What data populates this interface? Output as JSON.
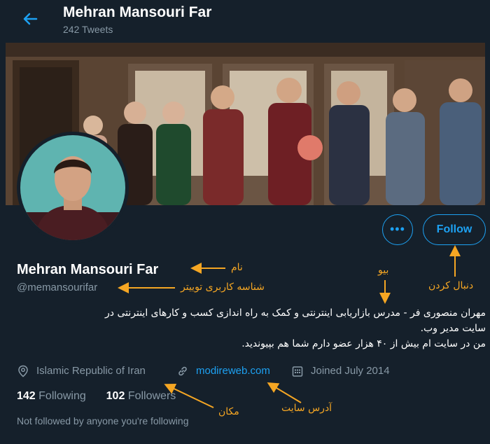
{
  "header": {
    "name": "Mehran Mansouri Far",
    "tweet_count": "242 Tweets"
  },
  "profile": {
    "name": "Mehran Mansouri Far",
    "handle": "@memansourifar",
    "bio_lines": [
      "مهران منصوری فر - مدرس بازاریابی اینترنتی و کمک به راه اندازی کسب و کارهای اینترنتی در",
      "سایت مدیر وب.",
      "من در سایت ام بیش از ۴۰ هزار عضو دارم شما هم بپیوندید."
    ],
    "location": "Islamic Republic of Iran",
    "website": "modireweb.com",
    "joined": "Joined July 2014",
    "following_count": "142",
    "following_label": "Following",
    "followers_count": "102",
    "followers_label": "Followers",
    "not_followed": "Not followed by anyone you're following"
  },
  "actions": {
    "more_label": "•••",
    "follow_label": "Follow"
  },
  "annotations": {
    "name": "نام",
    "username": "شناسه کاربری توییتر",
    "bio": "بیو",
    "follow": "دنبال کردن",
    "location": "مکان",
    "website": "آدرس سایت"
  },
  "colors": {
    "background": "#15202b",
    "accent": "#1da1f2",
    "muted": "#8899a6",
    "annotation": "#f5a623"
  }
}
